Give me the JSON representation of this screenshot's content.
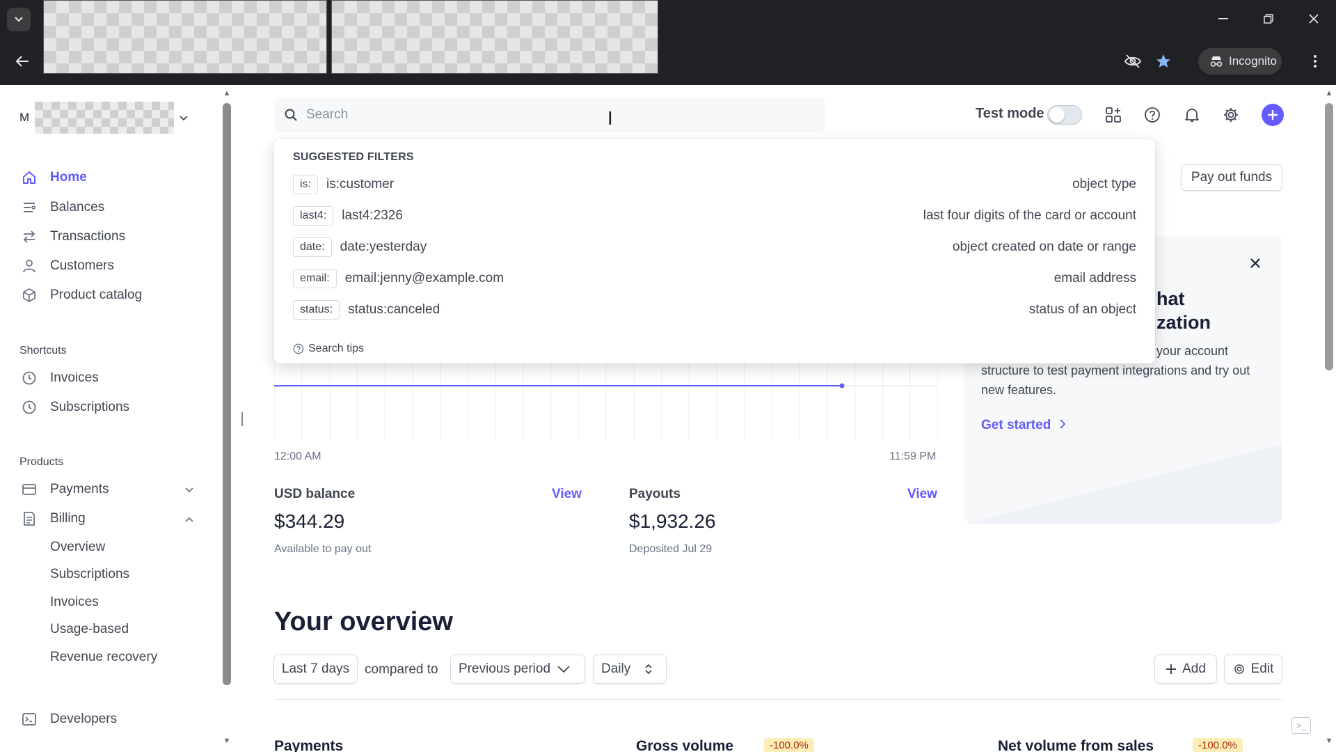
{
  "browser": {
    "incognito_label": "Incognito"
  },
  "sidebar": {
    "account_letter": "M",
    "nav": [
      {
        "label": "Home",
        "icon": "home-icon"
      },
      {
        "label": "Balances",
        "icon": "balances-icon"
      },
      {
        "label": "Transactions",
        "icon": "transactions-icon"
      },
      {
        "label": "Customers",
        "icon": "customers-icon"
      },
      {
        "label": "Product catalog",
        "icon": "product-catalog-icon"
      }
    ],
    "shortcuts_heading": "Shortcuts",
    "shortcuts": [
      {
        "label": "Invoices",
        "icon": "clock-icon"
      },
      {
        "label": "Subscriptions",
        "icon": "clock-icon"
      }
    ],
    "products_heading": "Products",
    "products": [
      {
        "label": "Payments",
        "icon": "payments-icon"
      },
      {
        "label": "Billing",
        "icon": "billing-icon"
      }
    ],
    "billing_sub": [
      "Overview",
      "Subscriptions",
      "Invoices",
      "Usage-based",
      "Revenue recovery"
    ],
    "developers": "Developers"
  },
  "header": {
    "search_placeholder": "Search",
    "test_mode_label": "Test mode",
    "test_mode_on": false
  },
  "search_dropdown": {
    "heading": "SUGGESTED FILTERS",
    "filters": [
      {
        "key": "is:",
        "example": "is:customer",
        "description": "object type"
      },
      {
        "key": "last4:",
        "example": "last4:2326",
        "description": "last four digits of the card or account"
      },
      {
        "key": "date:",
        "example": "date:yesterday",
        "description": "object created on date or range"
      },
      {
        "key": "email:",
        "example": "email:jenny@example.com",
        "description": "email address"
      },
      {
        "key": "status:",
        "example": "status:canceled",
        "description": "status of an object"
      }
    ],
    "tips": "Search tips"
  },
  "actions": {
    "pay_out_funds": "Pay out funds"
  },
  "today_chart": {
    "start_label": "12:00 AM",
    "end_label": "11:59 PM"
  },
  "balances": {
    "usd": {
      "title": "USD balance",
      "link": "View",
      "value": "$344.29",
      "sub": "Available to pay out"
    },
    "payouts": {
      "title": "Payouts",
      "link": "View",
      "value": "$1,932.26",
      "sub": "Deposited Jul 29"
    }
  },
  "promo_card": {
    "title_line1": "hat",
    "title_line2": "zation",
    "text_line1": "n your account",
    "text_rest": "structure to test payment integrations and try out new features.",
    "link": "Get started"
  },
  "overview": {
    "title": "Your overview",
    "range": "Last 7 days",
    "compared_to": "compared to",
    "comparison": "Previous period",
    "interval": "Daily",
    "add": "Add",
    "edit": "Edit",
    "metrics": [
      {
        "label": "Payments"
      },
      {
        "label": "Gross volume",
        "badge": "-100.0%"
      },
      {
        "label": "Net volume from sales",
        "badge": "-100.0%"
      }
    ]
  },
  "colors": {
    "accent": "#635bff",
    "chrome": "#202124"
  }
}
